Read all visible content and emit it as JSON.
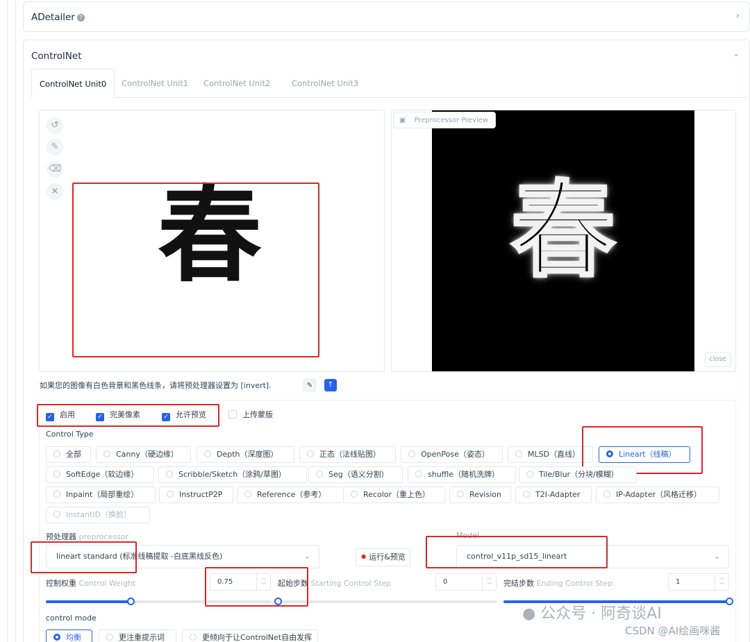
{
  "adetailer": {
    "title": "ADetailer"
  },
  "controlnet": {
    "title": "ControlNet",
    "tabs": [
      "ControlNet Unit0",
      "ControlNet Unit1",
      "ControlNet Unit2",
      "ControlNet Unit3"
    ],
    "active_tab": 0
  },
  "image": {
    "character": "春"
  },
  "preview": {
    "label": "Preprocessor Preview",
    "close": "close"
  },
  "hint": {
    "text": "如果您的图像有白色背景和黑色线条，请将预处理器设置为 [invert]."
  },
  "checkboxes": [
    {
      "label": "启用",
      "checked": true
    },
    {
      "label": "完美像素",
      "checked": true
    },
    {
      "label": "允许预览",
      "checked": true
    },
    {
      "label": "上传蒙版",
      "checked": false
    }
  ],
  "control_type": {
    "label": "Control Type",
    "selected": "Lineart（线稿）",
    "options": [
      "全部",
      "Canny（硬边缘）",
      "Depth（深度图）",
      "正态（法线贴图）",
      "OpenPose（姿态）",
      "MLSD（直线）",
      "Lineart（线稿）",
      "SoftEdge（软边缘）",
      "Scribble/Sketch（涂鸦/草图）",
      "Seg（语义分割）",
      "shuffle（随机洗牌）",
      "Tile/Blur（分块/模糊）",
      "Inpaint（局部重绘）",
      "InstructP2P",
      "Reference（参考）",
      "Recolor（重上色）",
      "Revision",
      "T2I-Adapter",
      "IP-Adapter（风格迁移）",
      "InstantID（换脸）"
    ]
  },
  "preprocessor": {
    "label_cn": "预处理器",
    "label_en": "preprocessor",
    "value": "lineart standard (标准线稿提取 -白底黑线反色)"
  },
  "run_button": {
    "label": "运行&预览"
  },
  "model": {
    "label": "Model",
    "value": "control_v11p_sd15_lineart"
  },
  "control_weight": {
    "label_cn": "控制权重",
    "label_en": "Control Weight",
    "value": "0.75",
    "fraction": 0.375
  },
  "start_step": {
    "label_cn": "起始步数",
    "label_en": "Starting Control Step",
    "value": "0",
    "fraction": 0
  },
  "end_step": {
    "label_cn": "完结步数",
    "label_en": "Ending Control Step",
    "value": "1",
    "fraction": 1
  },
  "control_mode": {
    "label": "control mode",
    "options": [
      "均衡",
      "更注重提示词",
      "更倾向于让ControlNet自由发挥"
    ],
    "selected": 0
  },
  "watermark": {
    "wechat": "公众号 · 阿奇谈AI",
    "csdn": "CSDN @AI绘画咪酱"
  },
  "colors": {
    "accent": "#2563eb",
    "highlight": "#dc2626"
  }
}
